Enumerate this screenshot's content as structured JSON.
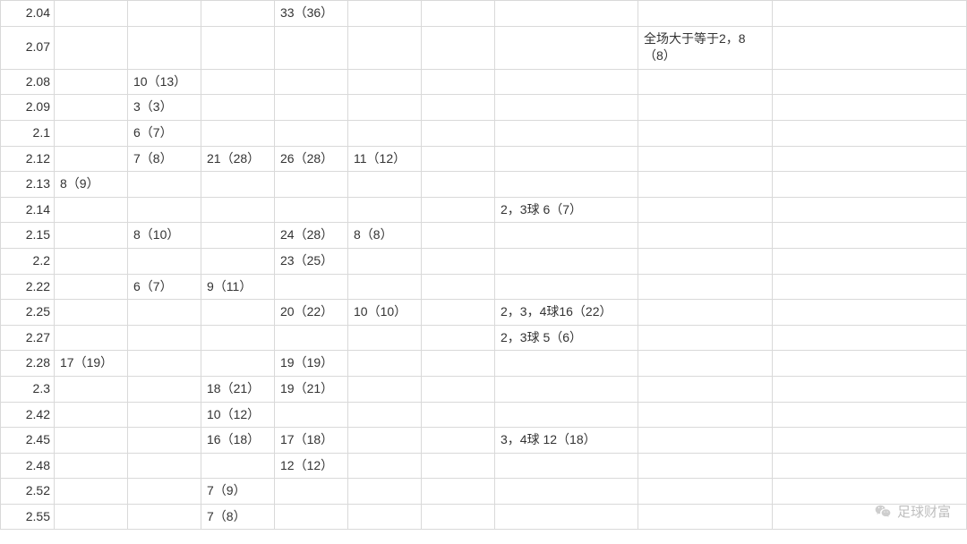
{
  "table": {
    "rows": [
      {
        "c0": "2.04",
        "c1": "",
        "c2": "",
        "c3": "",
        "c4": "33（36）",
        "c5": "",
        "c6": "",
        "c7": "",
        "c8": "",
        "c9": ""
      },
      {
        "c0": "2.07",
        "c1": "",
        "c2": "",
        "c3": "",
        "c4": "",
        "c5": "",
        "c6": "",
        "c7": "",
        "c8": "全场大于等于2，8（8）",
        "c9": ""
      },
      {
        "c0": "2.08",
        "c1": "",
        "c2": "10（13）",
        "c3": "",
        "c4": "",
        "c5": "",
        "c6": "",
        "c7": "",
        "c8": "",
        "c9": ""
      },
      {
        "c0": "2.09",
        "c1": "",
        "c2": "3（3）",
        "c3": "",
        "c4": "",
        "c5": "",
        "c6": "",
        "c7": "",
        "c8": "",
        "c9": ""
      },
      {
        "c0": "2.1",
        "c1": "",
        "c2": "6（7）",
        "c3": "",
        "c4": "",
        "c5": "",
        "c6": "",
        "c7": "",
        "c8": "",
        "c9": ""
      },
      {
        "c0": "2.12",
        "c1": "",
        "c2": "7（8）",
        "c3": "21（28）",
        "c4": "26（28）",
        "c5": "11（12）",
        "c6": "",
        "c7": "",
        "c8": "",
        "c9": ""
      },
      {
        "c0": "2.13",
        "c1": "8（9）",
        "c2": "",
        "c3": "",
        "c4": "",
        "c5": "",
        "c6": "",
        "c7": "",
        "c8": "",
        "c9": ""
      },
      {
        "c0": "2.14",
        "c1": "",
        "c2": "",
        "c3": "",
        "c4": "",
        "c5": "",
        "c6": "",
        "c7": "2，3球 6（7）",
        "c8": "",
        "c9": ""
      },
      {
        "c0": "2.15",
        "c1": "",
        "c2": "8（10）",
        "c3": "",
        "c4": "24（28）",
        "c5": "8（8）",
        "c6": "",
        "c7": "",
        "c8": "",
        "c9": ""
      },
      {
        "c0": "2.2",
        "c1": "",
        "c2": "",
        "c3": "",
        "c4": "23（25）",
        "c5": "",
        "c6": "",
        "c7": "",
        "c8": "",
        "c9": ""
      },
      {
        "c0": "2.22",
        "c1": "",
        "c2": "6（7）",
        "c3": "9（11）",
        "c4": "",
        "c5": "",
        "c6": "",
        "c7": "",
        "c8": "",
        "c9": ""
      },
      {
        "c0": "2.25",
        "c1": "",
        "c2": "",
        "c3": "",
        "c4": "20（22）",
        "c5": "10（10）",
        "c6": "",
        "c7": "2，3，4球16（22）",
        "c8": "",
        "c9": ""
      },
      {
        "c0": "2.27",
        "c1": "",
        "c2": "",
        "c3": "",
        "c4": "",
        "c5": "",
        "c6": "",
        "c7": "2，3球 5（6）",
        "c8": "",
        "c9": ""
      },
      {
        "c0": "2.28",
        "c1": "17（19）",
        "c2": "",
        "c3": "",
        "c4": "19（19）",
        "c5": "",
        "c6": "",
        "c7": "",
        "c8": "",
        "c9": ""
      },
      {
        "c0": "2.3",
        "c1": "",
        "c2": "",
        "c3": "18（21）",
        "c4": "19（21）",
        "c5": "",
        "c6": "",
        "c7": "",
        "c8": "",
        "c9": ""
      },
      {
        "c0": "2.42",
        "c1": "",
        "c2": "",
        "c3": "10（12）",
        "c4": "",
        "c5": "",
        "c6": "",
        "c7": "",
        "c8": "",
        "c9": ""
      },
      {
        "c0": "2.45",
        "c1": "",
        "c2": "",
        "c3": "16（18）",
        "c4": "17（18）",
        "c5": "",
        "c6": "",
        "c7": "3，4球 12（18）",
        "c8": "",
        "c9": ""
      },
      {
        "c0": "2.48",
        "c1": "",
        "c2": "",
        "c3": "",
        "c4": "12（12）",
        "c5": "",
        "c6": "",
        "c7": "",
        "c8": "",
        "c9": ""
      },
      {
        "c0": "2.52",
        "c1": "",
        "c2": "",
        "c3": "7（9）",
        "c4": "",
        "c5": "",
        "c6": "",
        "c7": "",
        "c8": "",
        "c9": ""
      },
      {
        "c0": "2.55",
        "c1": "",
        "c2": "",
        "c3": "7（8）",
        "c4": "",
        "c5": "",
        "c6": "",
        "c7": "",
        "c8": "",
        "c9": ""
      }
    ]
  },
  "watermark": {
    "text": "足球财富",
    "icon": "wechat-icon"
  }
}
